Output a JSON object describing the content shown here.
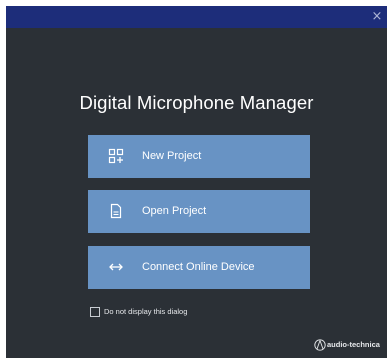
{
  "window": {
    "close_glyph": "×"
  },
  "app": {
    "title": "Digital Microphone Manager"
  },
  "actions": [
    {
      "label": "New Project",
      "icon": "new-project-grid-plus-icon"
    },
    {
      "label": "Open Project",
      "icon": "document-icon"
    },
    {
      "label": "Connect Online Device",
      "icon": "bidirectional-arrow-icon"
    }
  ],
  "options": {
    "do_not_display_label": "Do not display this dialog",
    "do_not_display_checked": false
  },
  "brand": {
    "name": "audio-technica"
  },
  "colors": {
    "titlebar": "#1d2d7a",
    "background": "#2b3036",
    "button": "#6893c4",
    "text": "#ffffff"
  }
}
